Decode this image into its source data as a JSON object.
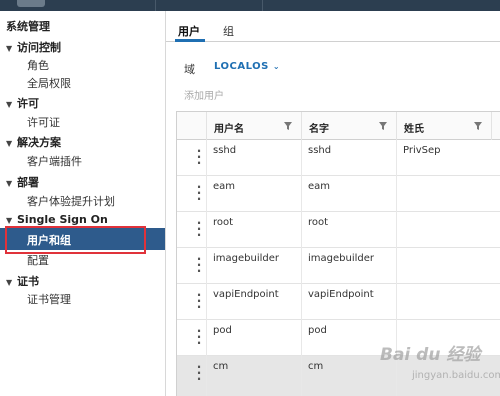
{
  "sidebar": {
    "title": "系统管理",
    "sections": [
      {
        "label": "访问控制",
        "items": [
          "角色",
          "全局权限"
        ]
      },
      {
        "label": "许可",
        "items": [
          "许可证"
        ]
      },
      {
        "label": "解决方案",
        "items": [
          "客户端插件"
        ]
      },
      {
        "label": "部署",
        "items": [
          "客户体验提升计划"
        ]
      },
      {
        "label": "Single Sign On",
        "items": [
          "用户和组",
          "配置"
        ]
      },
      {
        "label": "证书",
        "items": [
          "证书管理"
        ]
      }
    ],
    "active_item": "用户和组"
  },
  "main": {
    "tabs": [
      {
        "label": "用户",
        "active": true
      },
      {
        "label": "组",
        "active": false
      }
    ],
    "domain": {
      "label": "域",
      "value": "LOCALOS"
    },
    "add_user_label": "添加用户",
    "table": {
      "columns": [
        "用户名",
        "名字",
        "姓氏"
      ],
      "rows": [
        {
          "username": "sshd",
          "first_name": "sshd",
          "last_name": "PrivSep"
        },
        {
          "username": "eam",
          "first_name": "eam",
          "last_name": ""
        },
        {
          "username": "root",
          "first_name": "root",
          "last_name": ""
        },
        {
          "username": "imagebuilder",
          "first_name": "imagebuilder",
          "last_name": ""
        },
        {
          "username": "vapiEndpoint",
          "first_name": "vapiEndpoint",
          "last_name": ""
        },
        {
          "username": "pod",
          "first_name": "pod",
          "last_name": ""
        },
        {
          "username": "cm",
          "first_name": "cm",
          "last_name": ""
        }
      ],
      "selected_row_index": 6
    }
  },
  "watermark": {
    "main": "Bai du 经验",
    "sub": "jingyan.baidu.com"
  },
  "colors": {
    "accent": "#1f6fb2",
    "sidebar_active": "#2e5b8c",
    "highlight_border": "#e0323a",
    "topbar": "#2c3e50"
  }
}
